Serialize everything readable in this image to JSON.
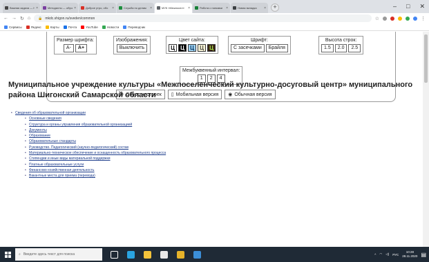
{
  "browser": {
    "tabs": [
      {
        "label": "Важная задача — Н",
        "color": "#444444",
        "active": false
      },
      {
        "label": "Методисты — обучение",
        "color": "#7a3ea0",
        "active": false
      },
      {
        "label": "Доброе утро, обо",
        "color": "#d93025",
        "active": false
      },
      {
        "label": "Служба по делам",
        "color": "#1e8e3e",
        "active": false
      },
      {
        "label": "МУК «Межпосел»",
        "color": "#5f6368",
        "active": true
      },
      {
        "label": "Работа с папками",
        "color": "#188038",
        "active": false
      },
      {
        "label": "Новая вкладка",
        "color": "#3c4043",
        "active": false
      }
    ],
    "url": "mkdc.shigon.ru/sveden/common",
    "bookmarks": [
      {
        "label": "Сервисы",
        "color": "#4285f4"
      },
      {
        "label": "Яндекс",
        "color": "#d93025"
      },
      {
        "label": "Карты",
        "color": "#fbbc04"
      },
      {
        "label": "Почта",
        "color": "#1a73e8"
      },
      {
        "label": "YouTube",
        "color": "#ff0000"
      },
      {
        "label": "Новости",
        "color": "#34a853"
      },
      {
        "label": "Переводчик",
        "color": "#4285f4"
      }
    ]
  },
  "accessibility": {
    "font_size_label": "Размер шрифта:",
    "font_smaller": "A-",
    "font_larger": "A+",
    "images_label": "Изображения:",
    "images_off": "Выключить",
    "color_label": "Цвет сайта:",
    "color_swatches": [
      {
        "letter": "Ц",
        "bg": "#ffffff",
        "fg": "#000000"
      },
      {
        "letter": "Ц",
        "bg": "#000000",
        "fg": "#ffffff"
      },
      {
        "letter": "Ц",
        "bg": "#9dd1f1",
        "fg": "#063462"
      },
      {
        "letter": "Ц",
        "bg": "#f7f3d6",
        "fg": "#4d4b43"
      },
      {
        "letter": "Ц",
        "bg": "#3b2716",
        "fg": "#a9e44d"
      }
    ],
    "font_label": "Шрифт:",
    "font_serif": "С засечками",
    "font_braille": "Брайля",
    "line_height_label": "Высота строк:",
    "line_heights": [
      "1.5",
      "2.0",
      "2.5"
    ],
    "letter_spacing_label": "Межбуквенный интервал:",
    "letter_spacings": [
      "1",
      "2",
      "4"
    ],
    "reset": "Сброс настроек",
    "mobile": "Мобильная версия",
    "normal": "Обычная версия"
  },
  "page": {
    "title": "Муниципальное учреждение культуры «Межпоселенческий культурно-досуговый центр» муниципального района Шигонский Самарской области",
    "nav_root": "Сведения об образовательной организации",
    "nav_items": [
      "Основные сведения",
      "Структура и органы управления образовательной организацией",
      "Документы",
      "Образование",
      "Образовательные стандарты",
      "Руководство. Педагогический (научно-педагогический) состав",
      "Материально-техническое обеспечение и оснащенность образовательного процесса",
      "Стипендии и иные виды материальной поддержки",
      "Платные образовательные услуги",
      "Финансово-хозяйственная деятельность",
      "Вакантные места для приема (перевода)"
    ]
  },
  "taskbar": {
    "search_placeholder": "Введите здесь текст для поиска",
    "apps": [
      {
        "name": "task-view-icon",
        "color": "#ffffff"
      },
      {
        "name": "edge-icon",
        "color": "#2aa3e0"
      },
      {
        "name": "explorer-icon",
        "color": "#f4c33b"
      },
      {
        "name": "store-icon",
        "color": "#e8e8e8"
      },
      {
        "name": "chrome-icon",
        "color": "#e6b32a"
      },
      {
        "name": "app-icon",
        "color": "#3c8fd8"
      }
    ],
    "lang": "РУС",
    "time": "10:28",
    "date": "28.11.2020"
  }
}
